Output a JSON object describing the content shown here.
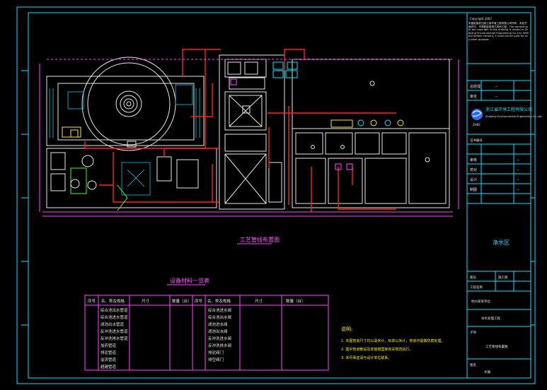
{
  "drawing": {
    "plan_title": "工艺管线布置图",
    "legend_title": "设备材料一览表",
    "zone_label": "净水区"
  },
  "equipment_table": {
    "headers": [
      "序号",
      "名、称及规格",
      "尺寸",
      "数量（台）",
      "序号",
      "名、称及规格",
      "尺寸",
      "数量（台）"
    ],
    "left_items": [
      "综合池出水管道",
      "综合池进水管道",
      "滤池出水管道",
      "反冲洗进水管道",
      "反冲洗排水管道",
      "加药管道",
      "排泥管道",
      "溢流管道",
      "超越管道"
    ],
    "right_items": [
      "综合池进水阀",
      "综合池出水阀",
      "滤池进水阀",
      "滤池出水阀",
      "反冲洗进水阀",
      "反冲洗排水阀",
      "排泥阀门",
      "排空阀门"
    ]
  },
  "notes": {
    "heading": "说明:",
    "lines": [
      "1. 本图管道尺寸均以毫米计，标高以米计，管道均需做防腐处理。",
      "2. 图中管道敷设及安装按国家有关规范执行。",
      "3. 未尽事宜请与设计单位联系。"
    ]
  },
  "title_block": {
    "copyright_label": "Copyright 2007",
    "copyright_text": "本图纸版权归浙江省环境工程有限公司所有，未经书面许可，不得复制或用于其他工程。The ownership of the copyright in this drawing is vested in Zhejiang Environmental Engineering Co.,Ltd. Without written consent, it must not be used for any other purpose.",
    "company_cn": "浙江省环境工程有限公司",
    "company_en": "Zhejiang Environmental Engineering Co.,Ltd.",
    "company_sub": "ZHEE",
    "cert_label": "证书编号",
    "rows": [
      {
        "k": "总经理",
        "v": "--"
      },
      {
        "k": "审定",
        "v": "--"
      },
      {
        "k": "审核",
        "v": "--"
      },
      {
        "k": "校对",
        "v": "--"
      },
      {
        "k": "设计",
        "v": "--"
      },
      {
        "k": "制图",
        "v": "--"
      }
    ],
    "design_phase": "施工图",
    "drawing_label": "图号",
    "project_label": "工程名称",
    "client": "杭州某某单位",
    "project_name": "净水处理工程",
    "subitem_label": "子项",
    "drawing_name": "工艺管线布置图",
    "sheet_label": "图名",
    "sheet_no": "水施-"
  }
}
